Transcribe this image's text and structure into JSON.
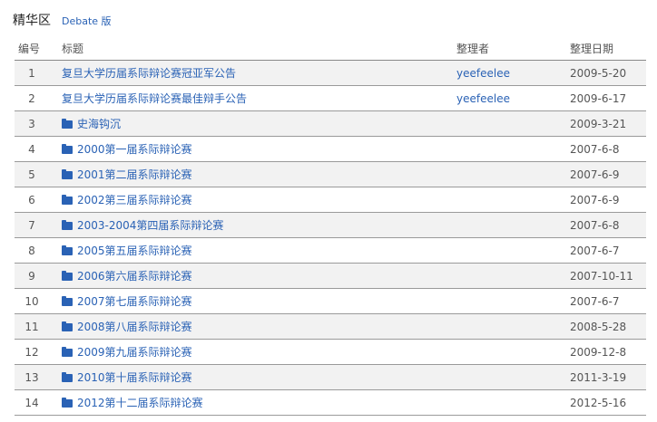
{
  "header": {
    "title": "精华区",
    "subtitle": "Debate 版"
  },
  "columns": {
    "num": "编号",
    "title": "标题",
    "editor": "整理者",
    "date": "整理日期"
  },
  "rows": [
    {
      "num": "1",
      "title": "复旦大学历届系际辩论赛冠亚军公告",
      "editor": "yeefeelee",
      "date": "2009-5-20",
      "folder": false
    },
    {
      "num": "2",
      "title": "复旦大学历届系际辩论赛最佳辩手公告",
      "editor": "yeefeelee",
      "date": "2009-6-17",
      "folder": false
    },
    {
      "num": "3",
      "title": "史海钩沉",
      "editor": "",
      "date": "2009-3-21",
      "folder": true
    },
    {
      "num": "4",
      "title": "2000第一届系际辩论赛",
      "editor": "",
      "date": "2007-6-8",
      "folder": true
    },
    {
      "num": "5",
      "title": "2001第二届系际辩论赛",
      "editor": "",
      "date": "2007-6-9",
      "folder": true
    },
    {
      "num": "6",
      "title": "2002第三届系际辩论赛",
      "editor": "",
      "date": "2007-6-9",
      "folder": true
    },
    {
      "num": "7",
      "title": "2003-2004第四届系际辩论赛",
      "editor": "",
      "date": "2007-6-8",
      "folder": true
    },
    {
      "num": "8",
      "title": "2005第五届系际辩论赛",
      "editor": "",
      "date": "2007-6-7",
      "folder": true
    },
    {
      "num": "9",
      "title": "2006第六届系际辩论赛",
      "editor": "",
      "date": "2007-10-11",
      "folder": true
    },
    {
      "num": "10",
      "title": "2007第七届系际辩论赛",
      "editor": "",
      "date": "2007-6-7",
      "folder": true
    },
    {
      "num": "11",
      "title": "2008第八届系际辩论赛",
      "editor": "",
      "date": "2008-5-28",
      "folder": true
    },
    {
      "num": "12",
      "title": "2009第九届系际辩论赛",
      "editor": "",
      "date": "2009-12-8",
      "folder": true
    },
    {
      "num": "13",
      "title": "2010第十届系际辩论赛",
      "editor": "",
      "date": "2011-3-19",
      "folder": true
    },
    {
      "num": "14",
      "title": "2012第十二届系际辩论赛",
      "editor": "",
      "date": "2012-5-16",
      "folder": true
    }
  ]
}
